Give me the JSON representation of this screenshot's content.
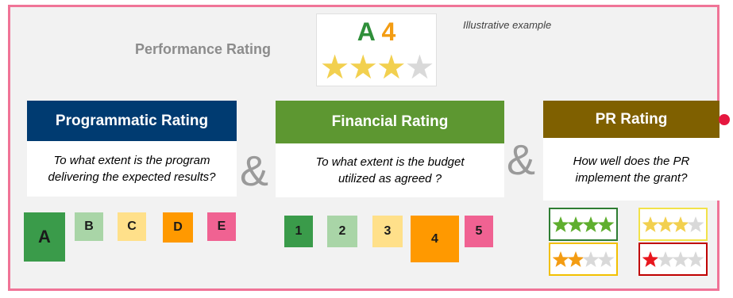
{
  "performance": {
    "label": "Performance Rating",
    "grade_letter": "A",
    "grade_number": "4",
    "stars_filled": 3,
    "stars_total": 4
  },
  "note": "Illustrative example",
  "ampersand": "&",
  "programmatic": {
    "title": "Programmatic Rating",
    "question": "To what extent is the program delivering the expected results?",
    "grades": [
      "A",
      "B",
      "C",
      "D",
      "E"
    ]
  },
  "financial": {
    "title": "Financial Rating",
    "question": "To what extent is the budget utilized as agreed ?",
    "grades": [
      "1",
      "2",
      "3",
      "4",
      "5"
    ]
  },
  "pr": {
    "title": "PR Rating",
    "question": "How well does the PR implement the grant?",
    "star_boxes": [
      {
        "filled": 4,
        "total": 4,
        "color": "#5fae2e",
        "border": "#2e7d32"
      },
      {
        "filled": 3,
        "total": 4,
        "color": "#f2d04f",
        "border": "#f2e24a"
      },
      {
        "filled": 2,
        "total": 4,
        "color": "#f39c12",
        "border": "#f2c000"
      },
      {
        "filled": 1,
        "total": 4,
        "color": "#e8171e",
        "border": "#c00000"
      }
    ]
  },
  "colors": {
    "frame": "#f07497",
    "programmatic_header": "#003b71",
    "financial_header": "#5d9731",
    "pr_header": "#7f6000",
    "grade_green": "#2f8f3a",
    "grade_orange": "#f39c12",
    "star_yellow": "#f2d04f",
    "star_empty": "#d9d9d9",
    "grade_A": "#3a9b4a",
    "grade_B": "#a9d5a7",
    "grade_C": "#ffe08a",
    "grade_D": "#ff9900",
    "grade_E": "#f06292"
  }
}
